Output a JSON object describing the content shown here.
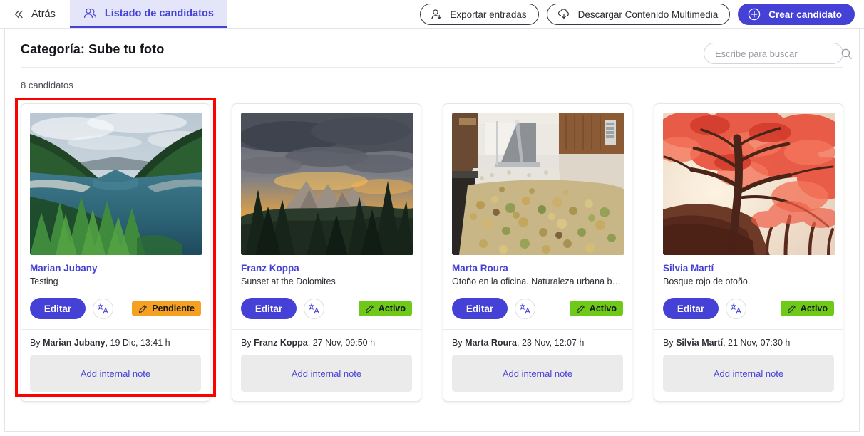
{
  "topbar": {
    "back_label": "Atrás",
    "back_icon": "chevron-double-left-icon",
    "tab_label": "Listado de candidatos",
    "tab_icon": "candidates-icon",
    "actions": [
      {
        "label": "Exportar entradas",
        "icon": "user-export-icon",
        "style": "outline"
      },
      {
        "label": "Descargar Contenido Multimedia",
        "icon": "cloud-download-icon",
        "style": "outline"
      },
      {
        "label": "Crear candidato",
        "icon": "plus-circle-icon",
        "style": "primary"
      }
    ]
  },
  "page": {
    "title": "Categoría: Sube tu foto",
    "count_label": "8 candidatos"
  },
  "search": {
    "placeholder": "Escribe para buscar",
    "value": "",
    "icon": "search-icon"
  },
  "labels": {
    "edit": "Editar",
    "translate_icon": "translate-icon",
    "badge_icon": "pencil-icon",
    "add_note": "Add internal note",
    "by_prefix": "By "
  },
  "colors": {
    "accent": "#4541d6",
    "tab_bg": "#e5e5fa",
    "badge_pending": "#f5a020",
    "badge_active": "#6fc919",
    "selection": "#ff0000",
    "note_bg": "#ebebeb"
  },
  "cards": [
    {
      "name": "Marian Jubany",
      "description": "Testing",
      "status": "Pendiente",
      "status_type": "pendiente",
      "author": "Marian Jubany",
      "date": ", 19 Dic, 13:41 h",
      "note": "Add internal note",
      "image": "lake-between-forested-hills",
      "selected": true
    },
    {
      "name": "Franz Koppa",
      "description": "Sunset at the Dolomites",
      "status": "Activo",
      "status_type": "activo",
      "author": "Franz Koppa",
      "date": ", 27 Nov, 09:50 h",
      "note": "Add internal note",
      "image": "dolomites-sunset-mountains",
      "selected": false
    },
    {
      "name": "Marta Roura",
      "description": "Otoño en la oficina. Naturaleza urbana by Jordi.",
      "status": "Activo",
      "status_type": "activo",
      "author": "Marta Roura",
      "date": ", 23 Nov, 12:07 h",
      "note": "Add internal note",
      "image": "office-lobby-with-leaves",
      "selected": false
    },
    {
      "name": "Silvia Martí",
      "description": "Bosque rojo de otoño.",
      "status": "Activo",
      "status_type": "activo",
      "author": "Silvia Martí",
      "date": ", 21 Nov, 07:30 h",
      "note": "Add internal note",
      "image": "red-autumn-forest",
      "selected": false
    }
  ]
}
